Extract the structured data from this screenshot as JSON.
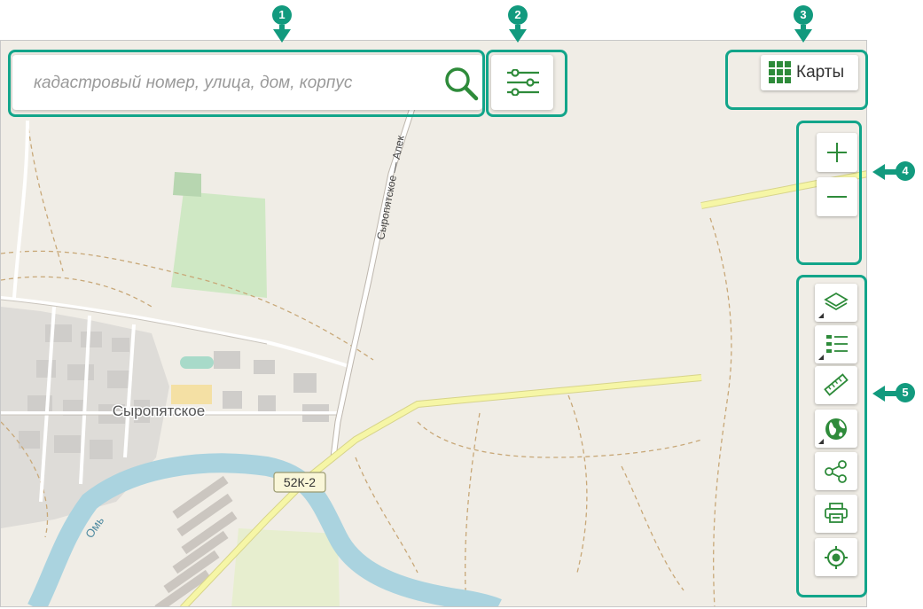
{
  "search": {
    "placeholder": "кадастровый номер, улица, дом, корпус"
  },
  "maps_button": {
    "label": "Карты"
  },
  "map": {
    "place_label": "Сыропятское",
    "road_label": "Сыропятское — Алек",
    "route_shield": "52К-2",
    "river_label": "Омь"
  },
  "annotations": [
    "1",
    "2",
    "3",
    "4",
    "5"
  ],
  "icons": {
    "search": "search-icon",
    "filter": "sliders-icon",
    "maps": "grid-icon",
    "zoom_in": "plus-icon",
    "zoom_out": "minus-icon",
    "layers": "layers-icon",
    "legend": "legend-list-icon",
    "measure": "ruler-icon",
    "basemap": "globe-icon",
    "share": "share-icon",
    "print": "printer-icon",
    "locate": "locate-icon"
  },
  "colors": {
    "accent": "#12a58a",
    "icon_green": "#2e8b3a",
    "map_bg": "#f0ede6",
    "river": "#aad3df",
    "road_yellow": "#f6f6a6"
  }
}
